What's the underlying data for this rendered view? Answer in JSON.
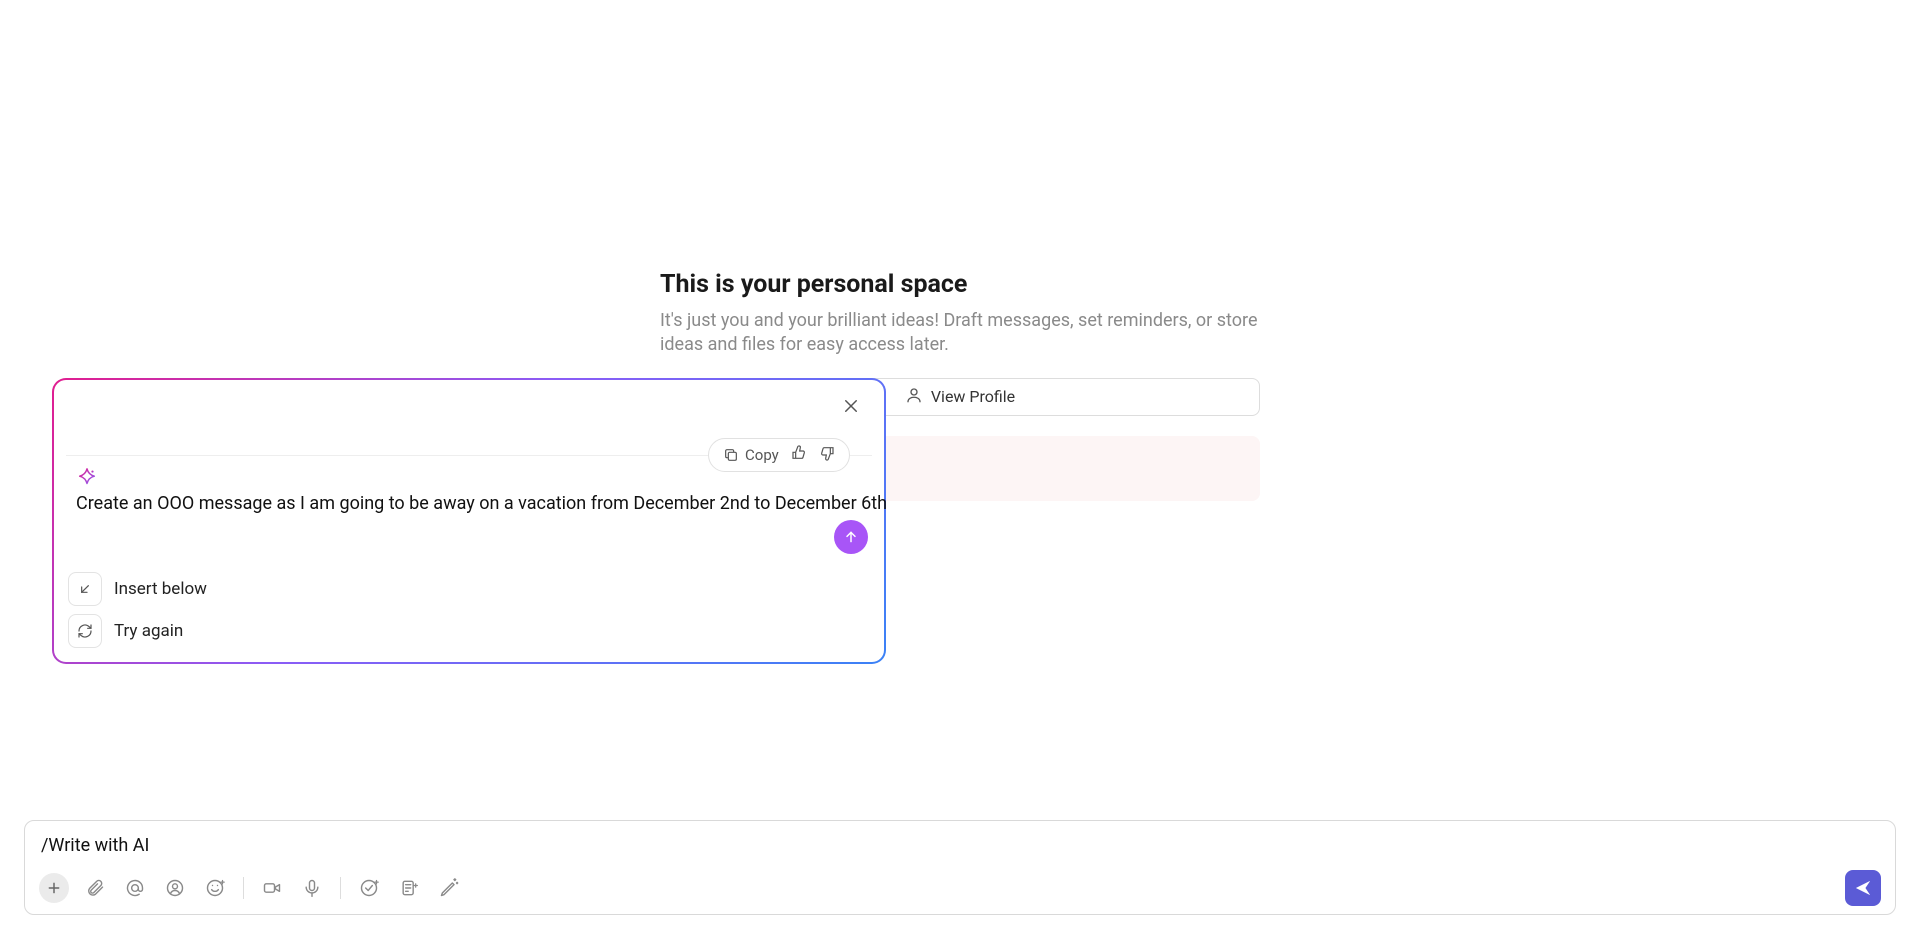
{
  "welcome": {
    "title": "This is your personal space",
    "subtitle": "It's just you and your brilliant ideas! Draft messages, set reminders, or store ideas and files for easy access later.",
    "view_profile_label": "View Profile"
  },
  "ai_popover": {
    "copy_label": "Copy",
    "prompt_text": "Create an OOO message as I am going to be away on a vacation from December 2nd to December 6th",
    "insert_below_label": "Insert below",
    "try_again_label": "Try again"
  },
  "composer": {
    "text": "/Write with AI"
  },
  "colors": {
    "ai_gradient_start": "#e11d8f",
    "ai_gradient_mid": "#8b5cf6",
    "ai_gradient_end": "#3b82f6",
    "send_button": "#5b5bd6",
    "ai_send_button": "#a855f7"
  }
}
